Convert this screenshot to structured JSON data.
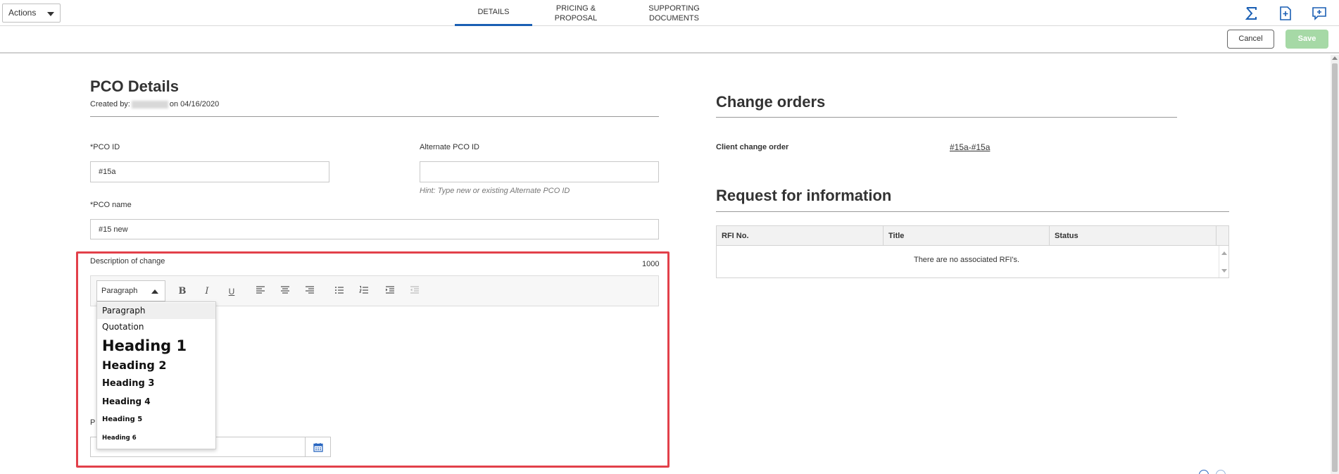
{
  "topbar": {
    "actions_label": "Actions",
    "tabs": [
      {
        "label": "DETAILS",
        "active": true
      },
      {
        "label": "PRICING & PROPOSAL",
        "active": false
      },
      {
        "label": "SUPPORTING DOCUMENTS",
        "active": false
      }
    ],
    "icons": [
      "sigma-icon",
      "add-document-icon",
      "add-comment-icon"
    ],
    "accent_color": "#1a5fb4"
  },
  "subbar": {
    "cancel_label": "Cancel",
    "save_label": "Save"
  },
  "details": {
    "title": "PCO Details",
    "created_prefix": "Created by:",
    "created_suffix": "on 04/16/2020",
    "pco_id_label": "*PCO ID",
    "pco_id_value": "#15a",
    "alt_pco_id_label": "Alternate PCO ID",
    "alt_pco_id_value": "",
    "alt_pco_hint": "Hint: Type new or existing Alternate PCO ID",
    "pco_name_label": "*PCO name",
    "pco_name_value": "#15 new",
    "description_label": "Description of change",
    "char_limit": "1000",
    "hidden_label_fragment": "P"
  },
  "editor": {
    "format_selected": "Paragraph",
    "toolbar_icons": [
      "bold-icon",
      "italic-icon",
      "underline-icon",
      "align-left-icon",
      "align-center-icon",
      "align-right-icon",
      "bullet-list-icon",
      "numbered-list-icon",
      "indent-icon",
      "outdent-icon"
    ],
    "bold": "B",
    "italic": "I",
    "underline": "U",
    "format_options": [
      "Paragraph",
      "Quotation",
      "Heading 1",
      "Heading 2",
      "Heading 3",
      "Heading 4",
      "Heading 5",
      "Heading 6"
    ],
    "highlight_color": "#e2404a"
  },
  "change_orders": {
    "title": "Change orders",
    "client_label": "Client change order",
    "client_value": "#15a-#15a"
  },
  "rfi": {
    "title": "Request for information",
    "columns": [
      "RFI No.",
      "Title",
      "Status"
    ],
    "empty_message": "There are no associated RFI's."
  }
}
